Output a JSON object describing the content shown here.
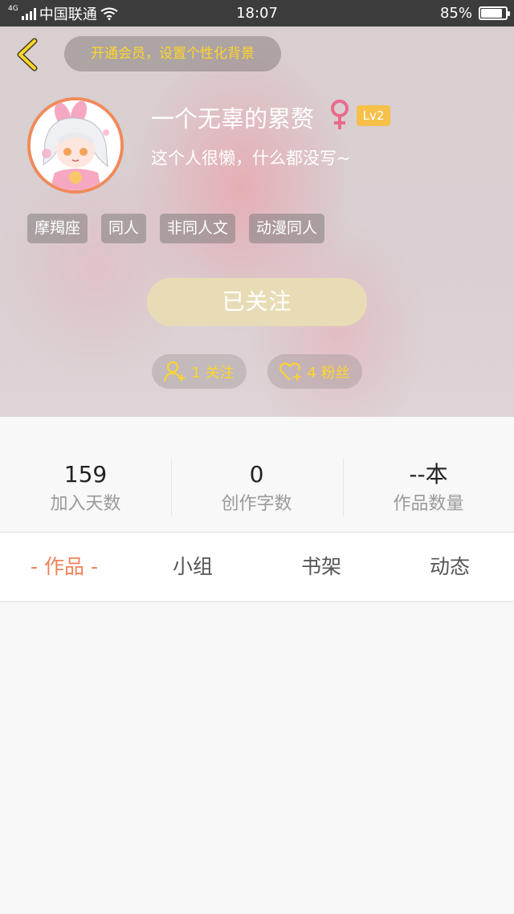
{
  "status_bar": {
    "network": "4G",
    "carrier": "中国联通",
    "time": "18:07",
    "battery_percent": "85%",
    "battery_level": 0.85
  },
  "header": {
    "vip_banner": "开通会员，设置个性化背景",
    "username": "一个无辜的累赘",
    "gender_symbol": "♀",
    "level": "Lv2",
    "bio": "这个人很懒，什么都没写~",
    "tags": [
      "摩羯座",
      "同人",
      "非同人文",
      "动漫同人"
    ],
    "follow_button": "已关注",
    "following": "1 关注",
    "fans": "4 粉丝"
  },
  "stats": [
    {
      "value": "159",
      "label": "加入天数"
    },
    {
      "value": "0",
      "label": "创作字数"
    },
    {
      "value": "--本",
      "label": "作品数量"
    }
  ],
  "tabs": [
    {
      "label": "- 作品 -",
      "active": true
    },
    {
      "label": "小组",
      "active": false
    },
    {
      "label": "书架",
      "active": false
    },
    {
      "label": "动态",
      "active": false
    }
  ],
  "colors": {
    "accent": "#f0825a",
    "gold": "#ffd52a",
    "level_badge": "#f6c04a",
    "follow_button": "#e8dcb6"
  }
}
